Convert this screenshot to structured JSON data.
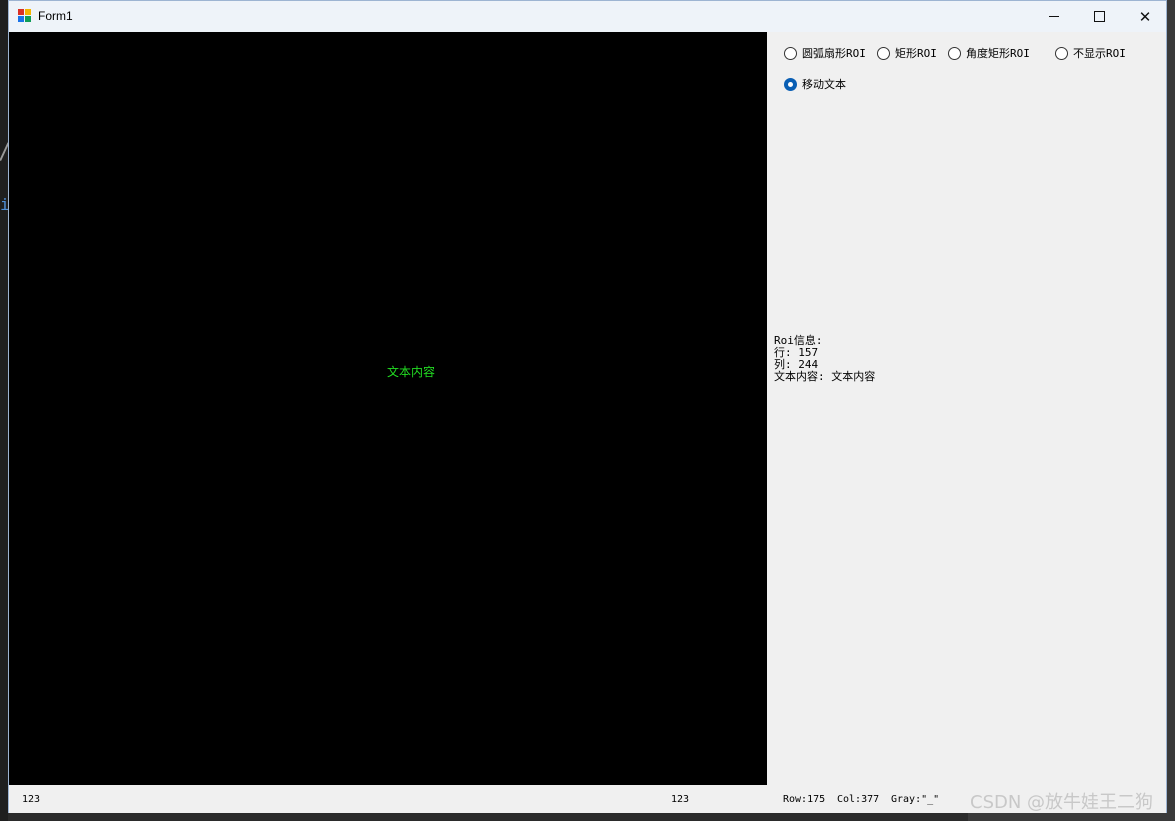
{
  "window": {
    "title": "Form1",
    "controls": {
      "minimize": "minimize",
      "maximize": "maximize",
      "close": "✕"
    }
  },
  "canvas": {
    "overlay_text": "文本内容",
    "overlay_color": "#22dd22"
  },
  "panel": {
    "radios": [
      {
        "label": "圆弧扇形ROI",
        "checked": false
      },
      {
        "label": "矩形ROI",
        "checked": false
      },
      {
        "label": "角度矩形ROI",
        "checked": false
      },
      {
        "label": "不显示ROI",
        "checked": false
      },
      {
        "label": "移动文本",
        "checked": true
      }
    ],
    "roi_info": {
      "title": "Roi信息:",
      "row": "行: 157",
      "col": "列: 244",
      "content": "文本内容: 文本内容"
    }
  },
  "status": {
    "left": "123",
    "middle": "123",
    "row": "Row:175",
    "col": "Col:377",
    "gray": "Gray:\"_\""
  },
  "watermark": "CSDN @放牛娃王二狗",
  "colors": {
    "accent": "#0a5fb4",
    "canvas_bg": "#000000",
    "panel_bg": "#f0f0f0"
  }
}
